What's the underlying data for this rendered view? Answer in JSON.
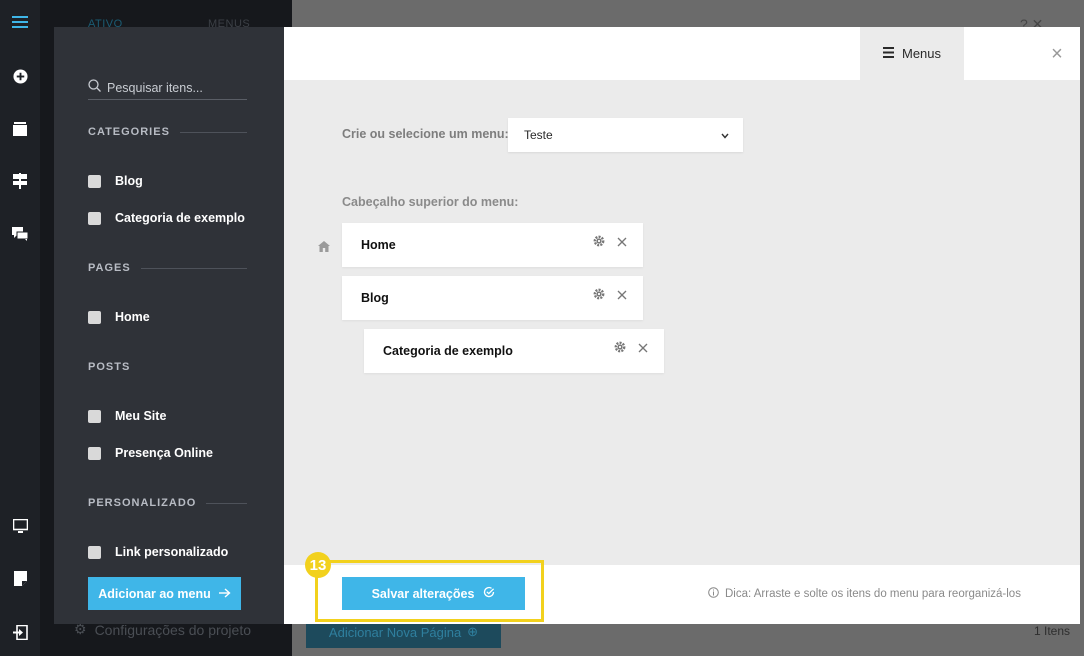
{
  "background": {
    "tab_active": "ATIVO",
    "tab_menus": "MENUS",
    "config_label": "Configurações do projeto",
    "add_page_label": "Adicionar Nova Página",
    "count_label": "1 Itens"
  },
  "rail": {
    "items": [
      {
        "icon": "hamburger-icon"
      },
      {
        "icon": "plus-circle-icon"
      },
      {
        "icon": "layers-icon"
      },
      {
        "icon": "sign-icon"
      },
      {
        "icon": "chat-icon"
      },
      {
        "icon": "monitor-icon"
      },
      {
        "icon": "note-icon"
      },
      {
        "icon": "exit-icon"
      }
    ]
  },
  "left": {
    "search_placeholder": "Pesquisar itens...",
    "sections": [
      {
        "title": "CATEGORIES",
        "items": [
          "Blog",
          "Categoria de exemplo"
        ]
      },
      {
        "title": "PAGES",
        "items": [
          "Home"
        ]
      },
      {
        "title": "POSTS",
        "items": [
          "Meu Site",
          "Presença Online"
        ]
      },
      {
        "title": "PERSONALIZADO",
        "items": [
          "Link personalizado"
        ]
      }
    ],
    "add_button": "Adicionar ao menu"
  },
  "header": {
    "tab_label": "Menus"
  },
  "main": {
    "select_label": "Crie ou selecione um menu:",
    "select_value": "Teste",
    "header_label": "Cabeçalho superior do menu:",
    "menu_items": [
      "Home",
      "Blog",
      "Categoria de exemplo"
    ]
  },
  "footer": {
    "save_button": "Salvar alterações",
    "tip": "Dica: Arraste e solte os itens do menu para reorganizá-los",
    "annotation_number": "13"
  },
  "colors": {
    "accent": "#3fb6e8",
    "highlight": "#f2d11d",
    "panel_dark": "#2f3238"
  }
}
